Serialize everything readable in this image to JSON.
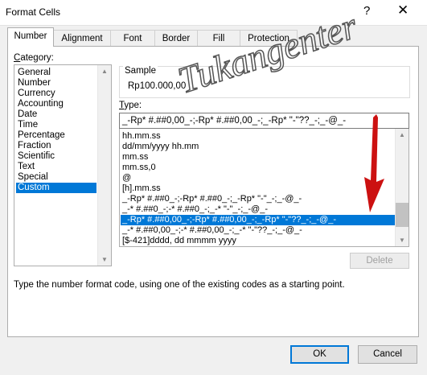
{
  "window": {
    "title": "Format Cells",
    "help": "?",
    "close": "✕"
  },
  "tabs": [
    "Number",
    "Alignment",
    "Font",
    "Border",
    "Fill",
    "Protection"
  ],
  "category": {
    "label_underlined": "C",
    "label_rest": "ategory:",
    "items": [
      "General",
      "Number",
      "Currency",
      "Accounting",
      "Date",
      "Time",
      "Percentage",
      "Fraction",
      "Scientific",
      "Text",
      "Special",
      "Custom"
    ],
    "selected": "Custom"
  },
  "sample": {
    "caption": "Sample",
    "value": "Rp100.000,00"
  },
  "type": {
    "label_underlined": "T",
    "label_rest": "ype:",
    "value": "_-Rp* #.##0,00_-;-Rp* #.##0,00_-;_-Rp* \"-\"??_-;_-@_-"
  },
  "format_list": {
    "items": [
      "hh.mm.ss",
      "dd/mm/yyyy hh.mm",
      "mm.ss",
      "mm.ss,0",
      "@",
      "[h].mm.ss",
      "_-Rp* #.##0_-;-Rp* #.##0_-;_-Rp* \"-\"_-;_-@_-",
      "_-* #.##0_-;-* #.##0_-;_-* \"-\"_-;_-@_-",
      "_-Rp* #.##0,00_-;-Rp* #.##0,00_-;_-Rp* \"-\"??_-;_-@_-",
      "_-* #.##0,00_-;-* #.##0,00_-;_-* \"-\"??_-;_-@_-",
      "[$-421]dddd, dd mmmm yyyy"
    ],
    "selected_index": 8
  },
  "buttons": {
    "delete": "Delete",
    "ok": "OK",
    "cancel": "Cancel"
  },
  "hint": "Type the number format code, using one of the existing codes as a starting point.",
  "watermark": "Tukangenter",
  "colors": {
    "selection": "#0078d7",
    "arrow": "#cc1111",
    "watermark": "#555555"
  }
}
